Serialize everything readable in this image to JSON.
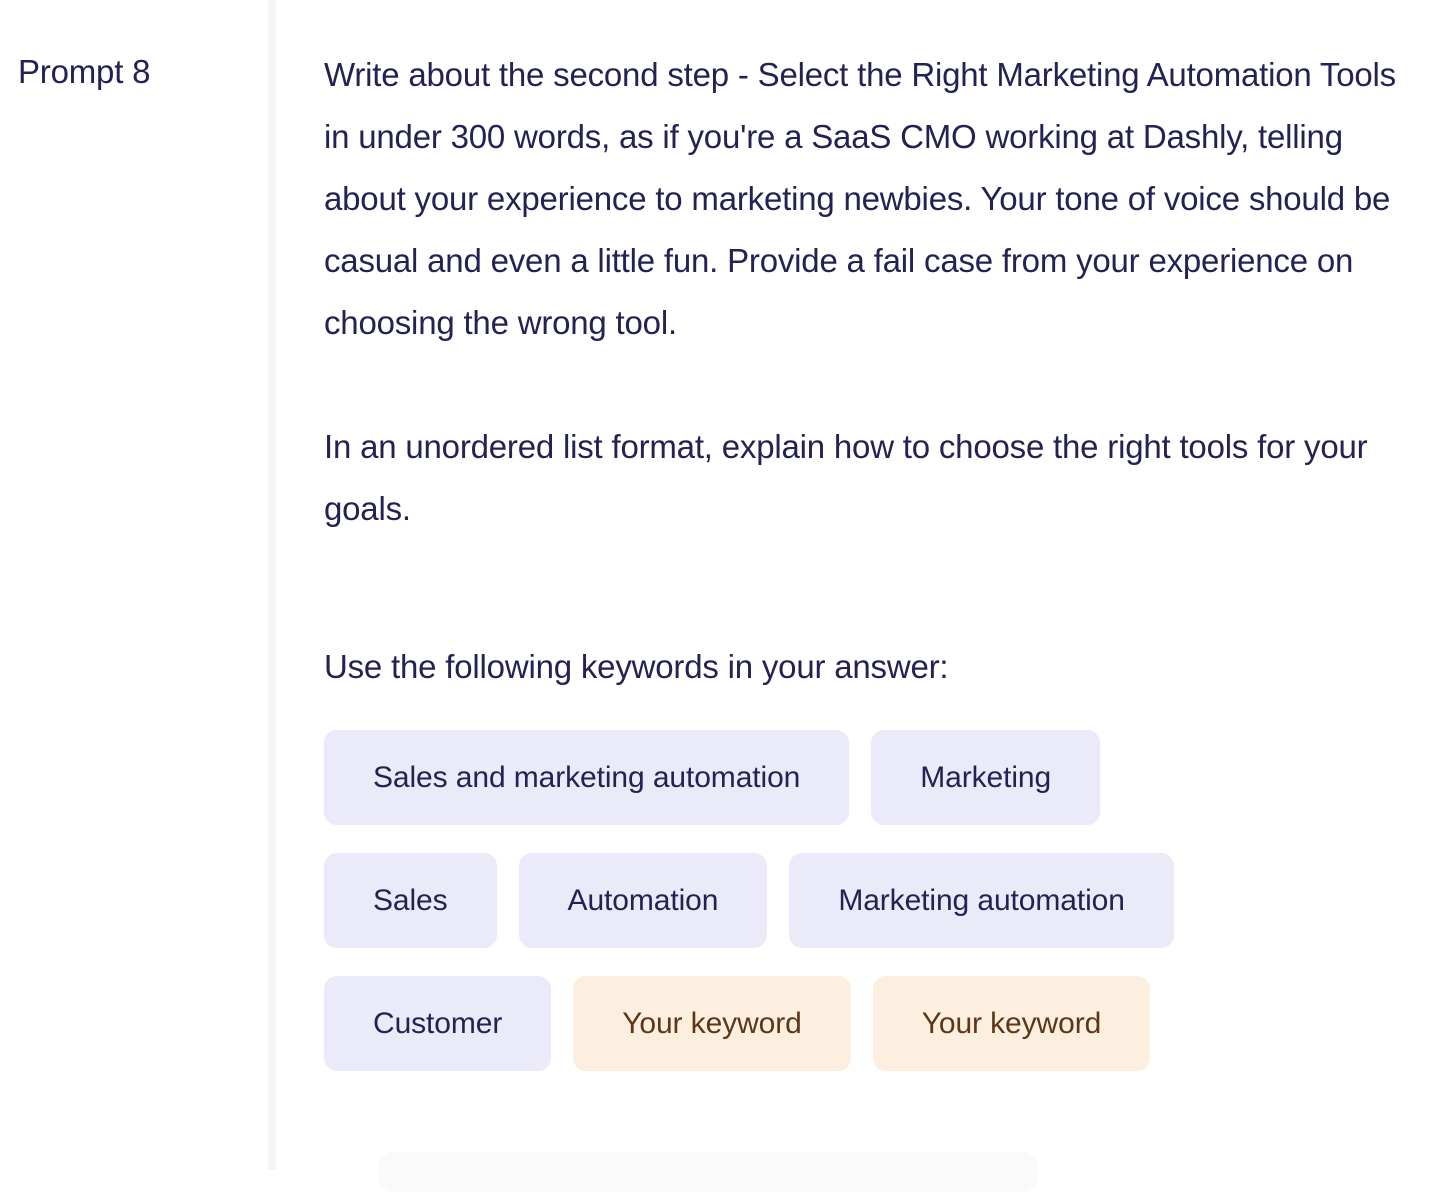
{
  "prompt": {
    "label": "Prompt 8",
    "paragraph_1": "Write about the second step - Select the Right Marketing Automation Tools in under 300 words, as if you're a SaaS CMO working at Dashly, telling about your experience to marketing newbies. Your tone of voice should be casual and even a little fun. Provide a fail case from your experience on choosing the wrong tool.",
    "paragraph_2": "In an unordered list format, explain how to choose the right tools for your goals.",
    "keywords_intro": "Use the following keywords in your answer:"
  },
  "keywords": {
    "rows": [
      [
        {
          "label": "Sales and marketing automation",
          "state": "filled"
        },
        {
          "label": "Marketing",
          "state": "filled"
        }
      ],
      [
        {
          "label": "Sales",
          "state": "filled"
        },
        {
          "label": "Automation",
          "state": "filled"
        },
        {
          "label": "Marketing automation",
          "state": "filled"
        }
      ],
      [
        {
          "label": "Customer",
          "state": "filled"
        },
        {
          "label": "Your keyword",
          "state": "empty"
        },
        {
          "label": "Your keyword",
          "state": "empty"
        }
      ]
    ]
  },
  "colors": {
    "text": "#232253",
    "chip_filled_bg": "#eaeaf8",
    "chip_filled_text": "#232253",
    "chip_empty_bg": "#fcefe0",
    "chip_empty_text": "#5d3617",
    "divider": "#f4f4f6",
    "page_bg": "#ffffff"
  }
}
